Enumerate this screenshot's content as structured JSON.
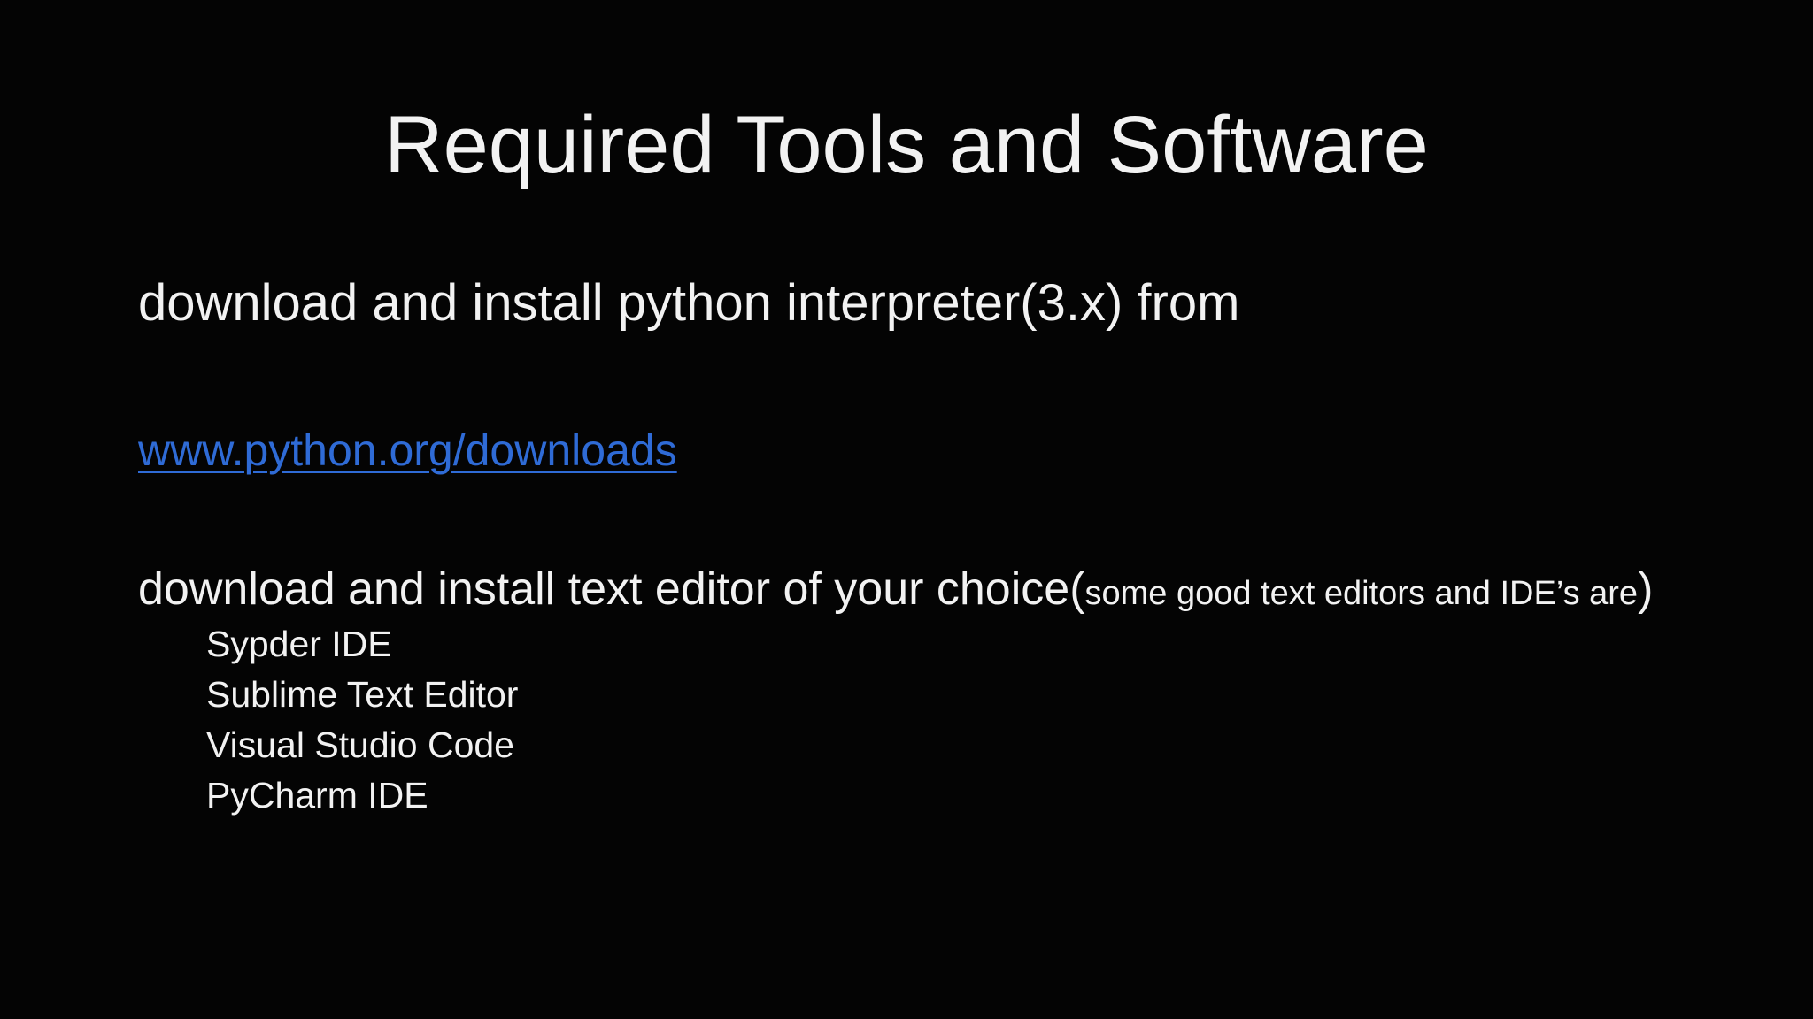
{
  "slide": {
    "title": "Required Tools and Software",
    "step1": "download and install python interpreter(3.x) from",
    "link": "www.python.org/downloads",
    "step2": {
      "main": "download and install text editor of your choice(",
      "small": "some good text editors and IDE’s are",
      "close": ")"
    },
    "tools": [
      "Sypder IDE",
      "Sublime Text Editor",
      "Visual Studio Code",
      "PyCharm IDE"
    ]
  },
  "colors": {
    "background": "#040404",
    "text": "#f2f2f2",
    "link": "#2f6bd6"
  }
}
